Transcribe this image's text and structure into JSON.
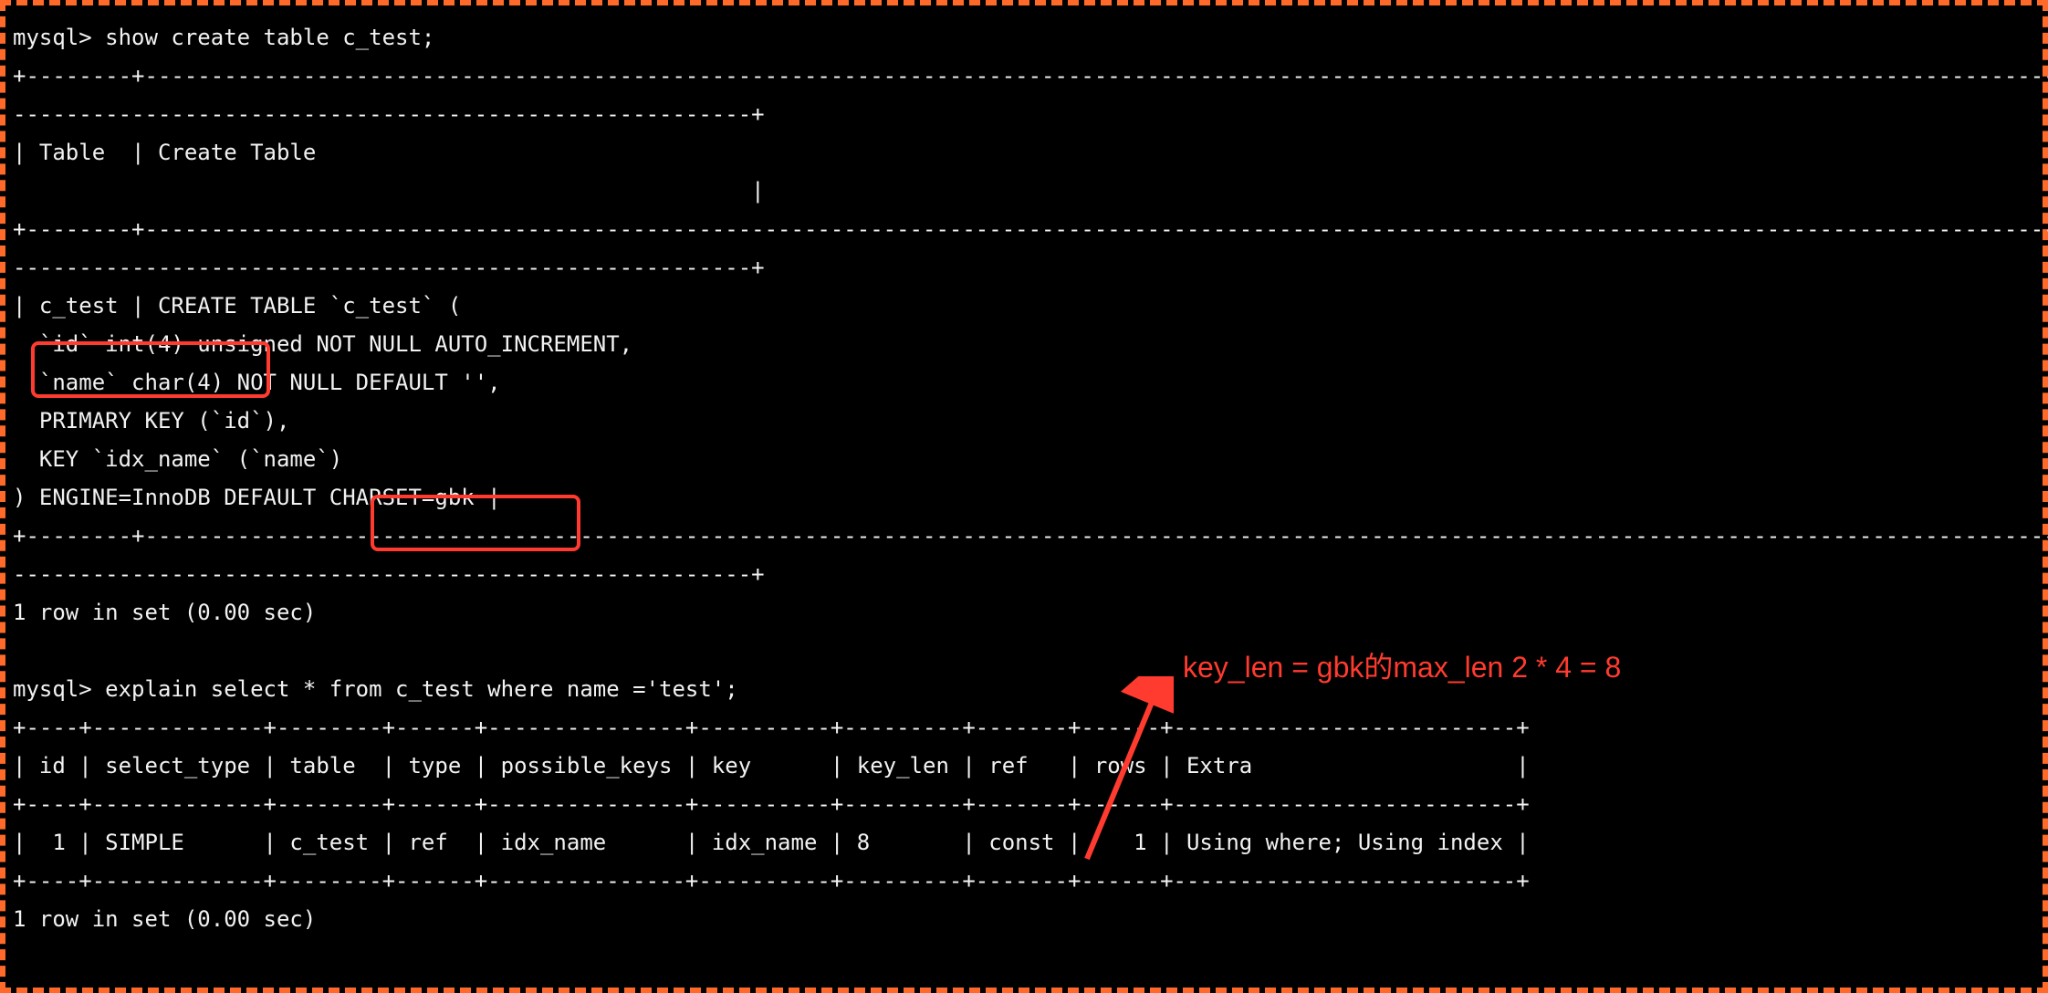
{
  "terminal": {
    "lines": [
      "mysql> show create table c_test;",
      "+--------+-----------------------------------------------------------------------------------------------------------------------------------------------------------------------------------------",
      "--------------------------------------------------------+",
      "| Table  | Create Table",
      "                                                        |",
      "+--------+-----------------------------------------------------------------------------------------------------------------------------------------------------------------------------------------",
      "--------------------------------------------------------+",
      "| c_test | CREATE TABLE `c_test` (",
      "  `id` int(4) unsigned NOT NULL AUTO_INCREMENT,",
      "  `name` char(4) NOT NULL DEFAULT '',",
      "  PRIMARY KEY (`id`),",
      "  KEY `idx_name` (`name`)",
      ") ENGINE=InnoDB DEFAULT CHARSET=gbk |",
      "+--------+-----------------------------------------------------------------------------------------------------------------------------------------------------------------------------------------",
      "--------------------------------------------------------+",
      "1 row in set (0.00 sec)",
      "",
      "mysql> explain select * from c_test where name ='test';",
      "+----+-------------+--------+------+---------------+----------+---------+-------+------+--------------------------+",
      "| id | select_type | table  | type | possible_keys | key      | key_len | ref   | rows | Extra                    |",
      "+----+-------------+--------+------+---------------+----------+---------+-------+------+--------------------------+",
      "|  1 | SIMPLE      | c_test | ref  | idx_name      | idx_name | 8       | const |    1 | Using where; Using index |",
      "+----+-------------+--------+------+---------------+----------+---------+-------+------+--------------------------+",
      "1 row in set (0.00 sec)",
      "",
      ""
    ]
  },
  "highlights": {
    "box_struck": {
      "text": "`id` int(4) unsigned"
    },
    "box_name_char": {
      "text": "`name` char(4)"
    },
    "box_charset": {
      "text": "CHARSET=gbk"
    }
  },
  "annotation": {
    "text": "key_len = gbk的max_len 2 * 4 = 8"
  }
}
